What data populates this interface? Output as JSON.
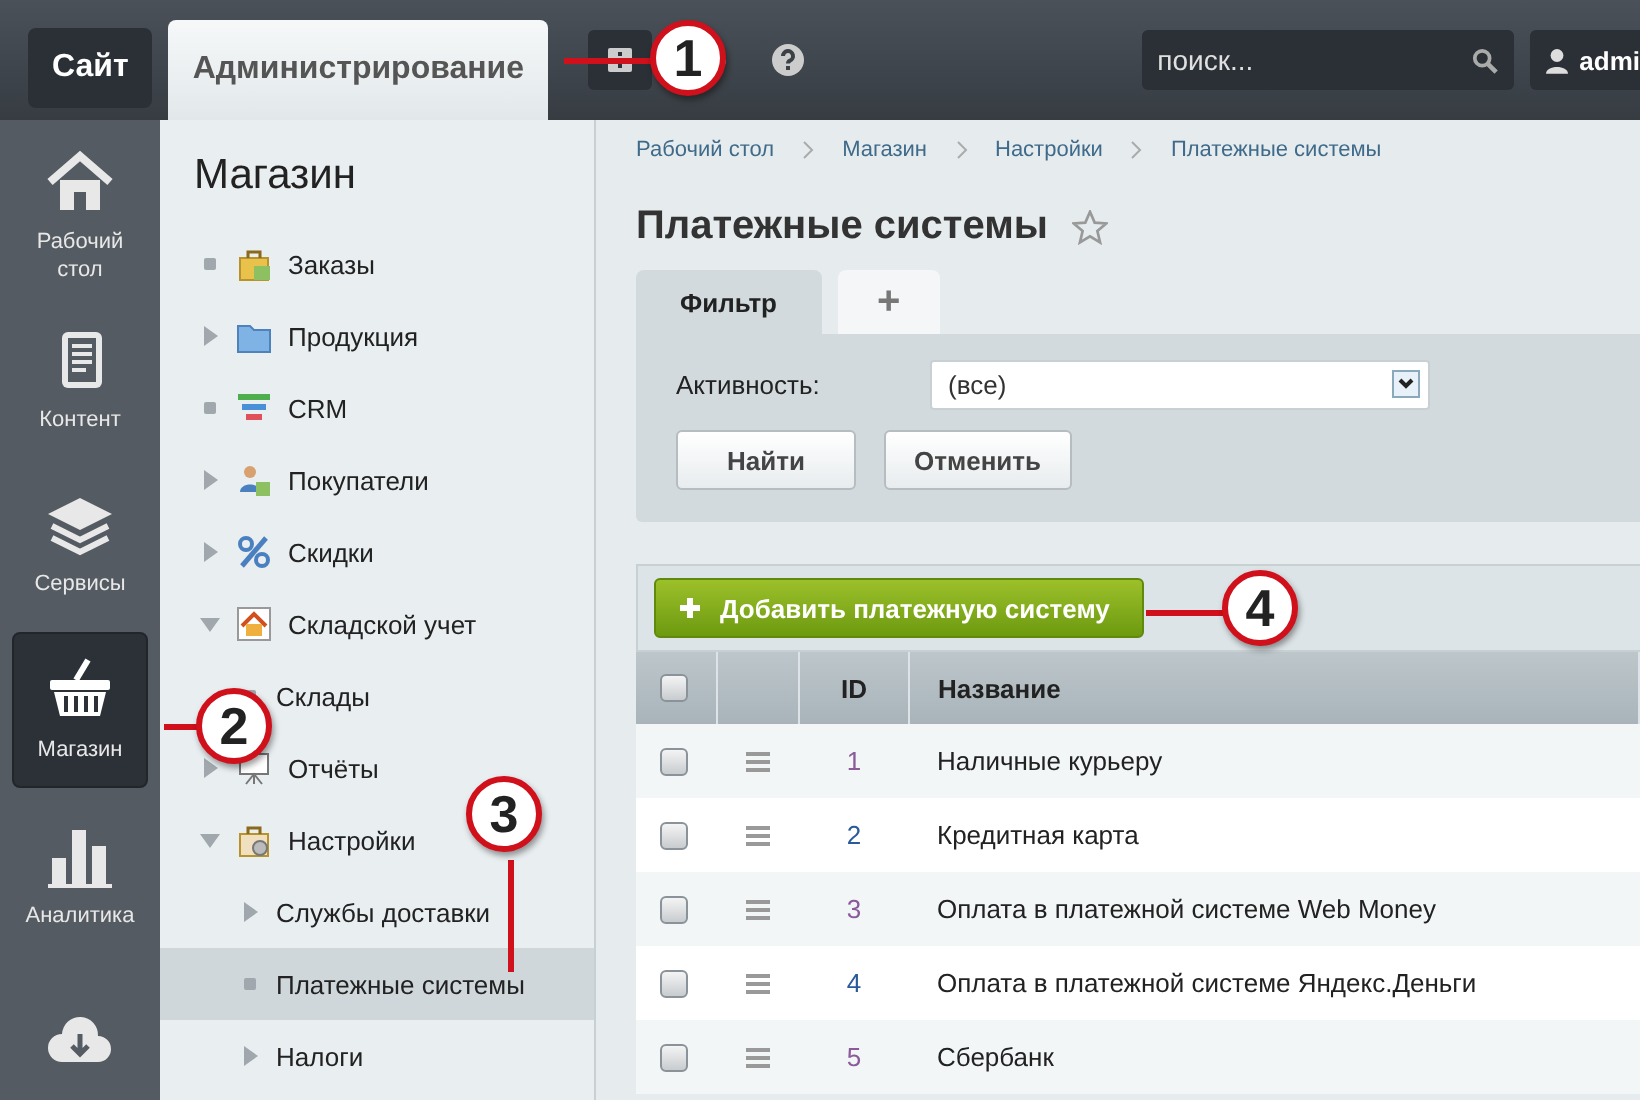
{
  "topbar": {
    "tabs": [
      {
        "label": "Сайт",
        "selected": false
      },
      {
        "label": "Администрирование",
        "selected": true
      }
    ],
    "search": {
      "placeholder": "поиск..."
    },
    "user": "admi"
  },
  "iconbar": [
    {
      "label": "Рабочий стол",
      "selected": false
    },
    {
      "label": "Контент",
      "selected": false
    },
    {
      "label": "Сервисы",
      "selected": false
    },
    {
      "label": "Магазин",
      "selected": true
    },
    {
      "label": "Аналитика",
      "selected": false
    },
    {
      "selected": false
    }
  ],
  "sidebar": {
    "title": "Магазин",
    "items": [
      {
        "label": "Заказы",
        "kind": "leaf",
        "selected": false
      },
      {
        "label": "Продукция",
        "kind": "folder",
        "expanded": false,
        "selected": false
      },
      {
        "label": "CRM",
        "kind": "leaf",
        "selected": false
      },
      {
        "label": "Покупатели",
        "kind": "folder",
        "expanded": false,
        "selected": false
      },
      {
        "label": "Скидки",
        "kind": "folder",
        "expanded": false,
        "selected": false
      },
      {
        "label": "Складской учет",
        "kind": "folder",
        "expanded": true,
        "selected": false,
        "children": [
          {
            "label": "Склады",
            "kind": "leaf",
            "selected": false
          }
        ]
      },
      {
        "label": "Отчёты",
        "kind": "folder",
        "expanded": false,
        "selected": false
      },
      {
        "label": "Настройки",
        "kind": "folder",
        "expanded": true,
        "selected": false,
        "children": [
          {
            "label": "Службы доставки",
            "kind": "folder",
            "expanded": false,
            "selected": false
          },
          {
            "label": "Платежные системы",
            "kind": "leaf",
            "selected": true
          },
          {
            "label": "Налоги",
            "kind": "folder",
            "expanded": false,
            "selected": false
          }
        ]
      }
    ]
  },
  "breadcrumbs": [
    "Рабочий стол",
    "Магазин",
    "Настройки",
    "Платежные системы"
  ],
  "page_title": "Платежные системы",
  "filter": {
    "tabs": [
      {
        "label": "Фильтр",
        "selected": true
      },
      {
        "label": "+",
        "selected": false
      }
    ],
    "field_label": "Активность:",
    "value": "(все)",
    "buttons": [
      "Найти",
      "Отменить"
    ]
  },
  "add_button": "Добавить платежную систему",
  "table": {
    "select_all_checked": false,
    "columns": [
      "ID",
      "Название"
    ],
    "rows": [
      {
        "id": "1",
        "name": "Наличные курьеру",
        "visited": true,
        "checked": false
      },
      {
        "id": "2",
        "name": "Кредитная карта",
        "visited": false,
        "checked": false
      },
      {
        "id": "3",
        "name": "Оплата в платежной системе Web Money",
        "visited": true,
        "checked": false
      },
      {
        "id": "4",
        "name": "Оплата в платежной системе Яндекс.Деньги",
        "visited": false,
        "checked": false
      },
      {
        "id": "5",
        "name": "Сбербанк",
        "visited": true,
        "checked": false
      }
    ]
  },
  "callouts": [
    "1",
    "2",
    "3",
    "4"
  ]
}
